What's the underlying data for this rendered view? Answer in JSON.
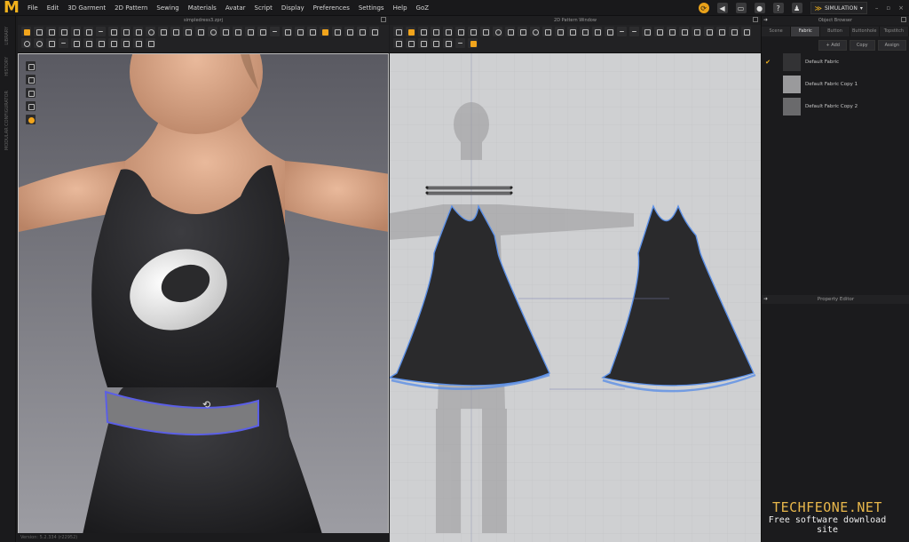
{
  "app": {
    "logo": "M"
  },
  "menu": [
    "File",
    "Edit",
    "3D Garment",
    "2D Pattern",
    "Sewing",
    "Materials",
    "Avatar",
    "Script",
    "Display",
    "Preferences",
    "Settings",
    "Help",
    "GoZ"
  ],
  "top_right": {
    "mode_label": "SIMULATION",
    "mode_dropdown": "▾",
    "min": "–",
    "max": "▫",
    "close": "×"
  },
  "left_strip": {
    "labels": [
      "LIBRARY",
      "HISTORY",
      "MODULAR CONFIGURATOR"
    ]
  },
  "window3d": {
    "title": "simpledress3.zprj"
  },
  "window2d": {
    "title": "2D Pattern Window"
  },
  "right_panel": {
    "title": "Object Browser",
    "tabs": [
      {
        "label": "Scene",
        "active": false
      },
      {
        "label": "Fabric",
        "active": true
      },
      {
        "label": "Button",
        "active": false
      },
      {
        "label": "Buttonhole",
        "active": false
      },
      {
        "label": "Topstitch",
        "active": false
      }
    ],
    "actions": {
      "add": "+ Add",
      "copy": "Copy",
      "assign": "Assign"
    },
    "fabrics": [
      {
        "name": "Default Fabric",
        "checked": true,
        "color": "#333335"
      },
      {
        "name": "Default Fabric Copy 1",
        "checked": false,
        "color": "#9a9a9c"
      },
      {
        "name": "Default Fabric Copy 2",
        "checked": false,
        "color": "#6a6a6c"
      }
    ],
    "property_editor": "Property Editor"
  },
  "status": {
    "text": "Version: 5.2.334 (r22952)"
  },
  "watermark": {
    "site": "TECHFEONE.NET",
    "tagline": "Free software download site"
  },
  "colors": {
    "accent": "#f2b21c",
    "seam": "#5b8fe6",
    "belt": "#7a7a7c"
  }
}
